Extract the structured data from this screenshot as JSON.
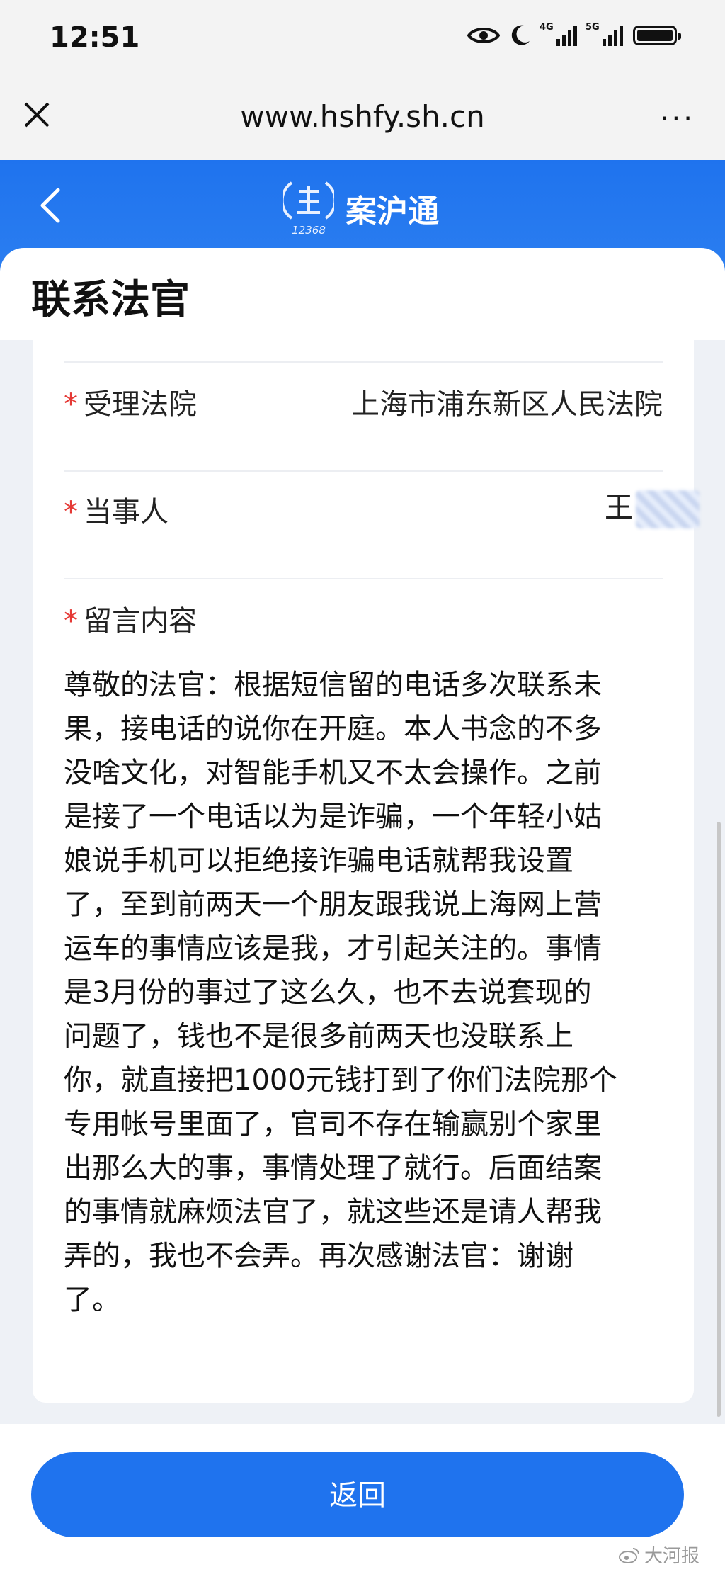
{
  "status_bar": {
    "time": "12:51",
    "network_1": "4G",
    "network_2": "5G",
    "icons": [
      "eye-icon",
      "moon-icon",
      "signal-4g-icon",
      "signal-5g-icon",
      "battery-icon"
    ]
  },
  "browser": {
    "url": "www.hshfy.sh.cn",
    "close_icon": "close-icon",
    "more_label": "···"
  },
  "app": {
    "title": "案沪通",
    "logo_text": "12368",
    "back_icon": "chevron-left-icon",
    "accent_color": "#1f73ee"
  },
  "page": {
    "title": "联系法官"
  },
  "form": {
    "required_mark": "*",
    "court_label": "受理法院",
    "court_value": "上海市浦东新区人民法院",
    "party_label": "当事人",
    "party_value": "王",
    "message_label": "留言内容",
    "message_lines": [
      "尊敬的法官：根据短信留的电话多次联系未",
      "果，接电话的说你在开庭。本人书念的不多",
      "没啥文化，对智能手机又不太会操作。之前",
      "是接了一个电话以为是诈骗，一个年轻小姑",
      "娘说手机可以拒绝接诈骗电话就帮我设置",
      "了，至到前两天一个朋友跟我说上海网上营",
      "运车的事情应该是我，才引起关注的。事情",
      "是3月份的事过了这么久，也不去说套现的",
      "问题了，钱也不是很多前两天也没联系上",
      "你，就直接把1000元钱打到了你们法院那个",
      "专用帐号里面了，官司不存在输赢别个家里",
      "出那么大的事，事情处理了就行。后面结案",
      "的事情就麻烦法官了，就这些还是请人帮我",
      "弄的，我也不会弄。再次感谢法官：谢谢",
      "了。"
    ]
  },
  "footer": {
    "return_label": "返回"
  },
  "watermark": {
    "text": "大河报"
  }
}
